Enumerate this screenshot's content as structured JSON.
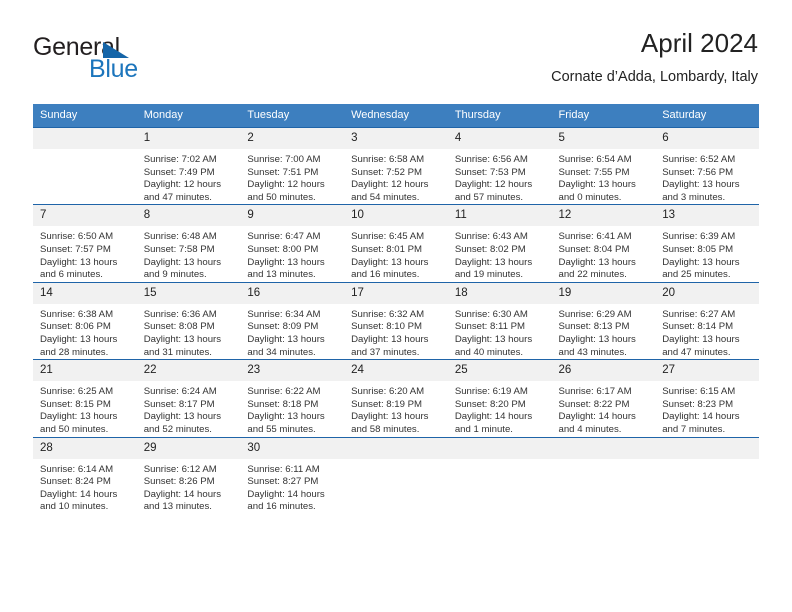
{
  "brand": {
    "name_primary": "General",
    "name_secondary": "Blue",
    "accent_color": "#1c75bc",
    "header_color": "#3d7fbf"
  },
  "header": {
    "title": "April 2024",
    "subtitle": "Cornate d’Adda, Lombardy, Italy"
  },
  "calendar": {
    "weekday_headers": [
      "Sunday",
      "Monday",
      "Tuesday",
      "Wednesday",
      "Thursday",
      "Friday",
      "Saturday"
    ],
    "weeks": [
      [
        {
          "day": "",
          "sunrise": "",
          "sunset": "",
          "daylight_line1": "",
          "daylight_line2": ""
        },
        {
          "day": "1",
          "sunrise": "Sunrise: 7:02 AM",
          "sunset": "Sunset: 7:49 PM",
          "daylight_line1": "Daylight: 12 hours",
          "daylight_line2": "and 47 minutes."
        },
        {
          "day": "2",
          "sunrise": "Sunrise: 7:00 AM",
          "sunset": "Sunset: 7:51 PM",
          "daylight_line1": "Daylight: 12 hours",
          "daylight_line2": "and 50 minutes."
        },
        {
          "day": "3",
          "sunrise": "Sunrise: 6:58 AM",
          "sunset": "Sunset: 7:52 PM",
          "daylight_line1": "Daylight: 12 hours",
          "daylight_line2": "and 54 minutes."
        },
        {
          "day": "4",
          "sunrise": "Sunrise: 6:56 AM",
          "sunset": "Sunset: 7:53 PM",
          "daylight_line1": "Daylight: 12 hours",
          "daylight_line2": "and 57 minutes."
        },
        {
          "day": "5",
          "sunrise": "Sunrise: 6:54 AM",
          "sunset": "Sunset: 7:55 PM",
          "daylight_line1": "Daylight: 13 hours",
          "daylight_line2": "and 0 minutes."
        },
        {
          "day": "6",
          "sunrise": "Sunrise: 6:52 AM",
          "sunset": "Sunset: 7:56 PM",
          "daylight_line1": "Daylight: 13 hours",
          "daylight_line2": "and 3 minutes."
        }
      ],
      [
        {
          "day": "7",
          "sunrise": "Sunrise: 6:50 AM",
          "sunset": "Sunset: 7:57 PM",
          "daylight_line1": "Daylight: 13 hours",
          "daylight_line2": "and 6 minutes."
        },
        {
          "day": "8",
          "sunrise": "Sunrise: 6:48 AM",
          "sunset": "Sunset: 7:58 PM",
          "daylight_line1": "Daylight: 13 hours",
          "daylight_line2": "and 9 minutes."
        },
        {
          "day": "9",
          "sunrise": "Sunrise: 6:47 AM",
          "sunset": "Sunset: 8:00 PM",
          "daylight_line1": "Daylight: 13 hours",
          "daylight_line2": "and 13 minutes."
        },
        {
          "day": "10",
          "sunrise": "Sunrise: 6:45 AM",
          "sunset": "Sunset: 8:01 PM",
          "daylight_line1": "Daylight: 13 hours",
          "daylight_line2": "and 16 minutes."
        },
        {
          "day": "11",
          "sunrise": "Sunrise: 6:43 AM",
          "sunset": "Sunset: 8:02 PM",
          "daylight_line1": "Daylight: 13 hours",
          "daylight_line2": "and 19 minutes."
        },
        {
          "day": "12",
          "sunrise": "Sunrise: 6:41 AM",
          "sunset": "Sunset: 8:04 PM",
          "daylight_line1": "Daylight: 13 hours",
          "daylight_line2": "and 22 minutes."
        },
        {
          "day": "13",
          "sunrise": "Sunrise: 6:39 AM",
          "sunset": "Sunset: 8:05 PM",
          "daylight_line1": "Daylight: 13 hours",
          "daylight_line2": "and 25 minutes."
        }
      ],
      [
        {
          "day": "14",
          "sunrise": "Sunrise: 6:38 AM",
          "sunset": "Sunset: 8:06 PM",
          "daylight_line1": "Daylight: 13 hours",
          "daylight_line2": "and 28 minutes."
        },
        {
          "day": "15",
          "sunrise": "Sunrise: 6:36 AM",
          "sunset": "Sunset: 8:08 PM",
          "daylight_line1": "Daylight: 13 hours",
          "daylight_line2": "and 31 minutes."
        },
        {
          "day": "16",
          "sunrise": "Sunrise: 6:34 AM",
          "sunset": "Sunset: 8:09 PM",
          "daylight_line1": "Daylight: 13 hours",
          "daylight_line2": "and 34 minutes."
        },
        {
          "day": "17",
          "sunrise": "Sunrise: 6:32 AM",
          "sunset": "Sunset: 8:10 PM",
          "daylight_line1": "Daylight: 13 hours",
          "daylight_line2": "and 37 minutes."
        },
        {
          "day": "18",
          "sunrise": "Sunrise: 6:30 AM",
          "sunset": "Sunset: 8:11 PM",
          "daylight_line1": "Daylight: 13 hours",
          "daylight_line2": "and 40 minutes."
        },
        {
          "day": "19",
          "sunrise": "Sunrise: 6:29 AM",
          "sunset": "Sunset: 8:13 PM",
          "daylight_line1": "Daylight: 13 hours",
          "daylight_line2": "and 43 minutes."
        },
        {
          "day": "20",
          "sunrise": "Sunrise: 6:27 AM",
          "sunset": "Sunset: 8:14 PM",
          "daylight_line1": "Daylight: 13 hours",
          "daylight_line2": "and 47 minutes."
        }
      ],
      [
        {
          "day": "21",
          "sunrise": "Sunrise: 6:25 AM",
          "sunset": "Sunset: 8:15 PM",
          "daylight_line1": "Daylight: 13 hours",
          "daylight_line2": "and 50 minutes."
        },
        {
          "day": "22",
          "sunrise": "Sunrise: 6:24 AM",
          "sunset": "Sunset: 8:17 PM",
          "daylight_line1": "Daylight: 13 hours",
          "daylight_line2": "and 52 minutes."
        },
        {
          "day": "23",
          "sunrise": "Sunrise: 6:22 AM",
          "sunset": "Sunset: 8:18 PM",
          "daylight_line1": "Daylight: 13 hours",
          "daylight_line2": "and 55 minutes."
        },
        {
          "day": "24",
          "sunrise": "Sunrise: 6:20 AM",
          "sunset": "Sunset: 8:19 PM",
          "daylight_line1": "Daylight: 13 hours",
          "daylight_line2": "and 58 minutes."
        },
        {
          "day": "25",
          "sunrise": "Sunrise: 6:19 AM",
          "sunset": "Sunset: 8:20 PM",
          "daylight_line1": "Daylight: 14 hours",
          "daylight_line2": "and 1 minute."
        },
        {
          "day": "26",
          "sunrise": "Sunrise: 6:17 AM",
          "sunset": "Sunset: 8:22 PM",
          "daylight_line1": "Daylight: 14 hours",
          "daylight_line2": "and 4 minutes."
        },
        {
          "day": "27",
          "sunrise": "Sunrise: 6:15 AM",
          "sunset": "Sunset: 8:23 PM",
          "daylight_line1": "Daylight: 14 hours",
          "daylight_line2": "and 7 minutes."
        }
      ],
      [
        {
          "day": "28",
          "sunrise": "Sunrise: 6:14 AM",
          "sunset": "Sunset: 8:24 PM",
          "daylight_line1": "Daylight: 14 hours",
          "daylight_line2": "and 10 minutes."
        },
        {
          "day": "29",
          "sunrise": "Sunrise: 6:12 AM",
          "sunset": "Sunset: 8:26 PM",
          "daylight_line1": "Daylight: 14 hours",
          "daylight_line2": "and 13 minutes."
        },
        {
          "day": "30",
          "sunrise": "Sunrise: 6:11 AM",
          "sunset": "Sunset: 8:27 PM",
          "daylight_line1": "Daylight: 14 hours",
          "daylight_line2": "and 16 minutes."
        },
        {
          "day": "",
          "sunrise": "",
          "sunset": "",
          "daylight_line1": "",
          "daylight_line2": ""
        },
        {
          "day": "",
          "sunrise": "",
          "sunset": "",
          "daylight_line1": "",
          "daylight_line2": ""
        },
        {
          "day": "",
          "sunrise": "",
          "sunset": "",
          "daylight_line1": "",
          "daylight_line2": ""
        },
        {
          "day": "",
          "sunrise": "",
          "sunset": "",
          "daylight_line1": "",
          "daylight_line2": ""
        }
      ]
    ]
  }
}
